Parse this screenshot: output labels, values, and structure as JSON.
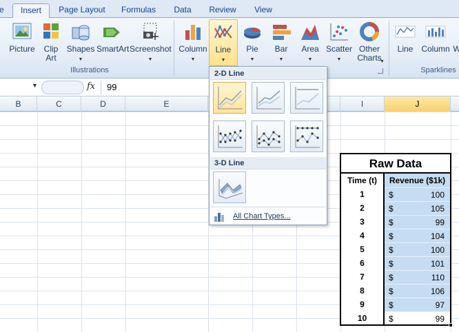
{
  "tabs": [
    {
      "label": "le",
      "active": false
    },
    {
      "label": "Insert",
      "active": true
    },
    {
      "label": "Page Layout",
      "active": false
    },
    {
      "label": "Formulas",
      "active": false
    },
    {
      "label": "Data",
      "active": false
    },
    {
      "label": "Review",
      "active": false
    },
    {
      "label": "View",
      "active": false
    }
  ],
  "ribbon": {
    "illustrations": {
      "group_label": "Illustrations",
      "picture": "Picture",
      "clip_art_1": "Clip",
      "clip_art_2": "Art",
      "shapes": "Shapes",
      "smartart": "SmartArt",
      "screenshot": "Screenshot"
    },
    "charts": {
      "column": "Column",
      "line": "Line",
      "pie": "Pie",
      "bar": "Bar",
      "area": "Area",
      "scatter": "Scatter",
      "other_1": "Other",
      "other_2": "Charts"
    },
    "sparklines": {
      "group_label": "Sparklines",
      "line": "Line",
      "column": "Column",
      "winloss": "W"
    }
  },
  "formula_bar": {
    "fx": "fx",
    "value": "99"
  },
  "columns": [
    "B",
    "C",
    "D",
    "E",
    "I",
    "J"
  ],
  "selected_column": "J",
  "line_menu": {
    "section_2d": "2-D Line",
    "section_3d": "3-D Line",
    "all_chart_types": "All Chart Types..."
  },
  "raw_data": {
    "title": "Raw Data",
    "header_time": "Time (t)",
    "header_revenue": "Revenue ($1k)",
    "currency": "$",
    "rows": [
      {
        "t": "1",
        "rev": "100"
      },
      {
        "t": "2",
        "rev": "105"
      },
      {
        "t": "3",
        "rev": "99"
      },
      {
        "t": "4",
        "rev": "104"
      },
      {
        "t": "5",
        "rev": "100"
      },
      {
        "t": "6",
        "rev": "101"
      },
      {
        "t": "7",
        "rev": "110"
      },
      {
        "t": "8",
        "rev": "106"
      },
      {
        "t": "9",
        "rev": "97"
      },
      {
        "t": "10",
        "rev": "99"
      }
    ]
  },
  "colors": {
    "selection_fill": "#c5dcf3",
    "ribbon_highlight": "#ffe28a",
    "tab_text": "#15428b"
  }
}
